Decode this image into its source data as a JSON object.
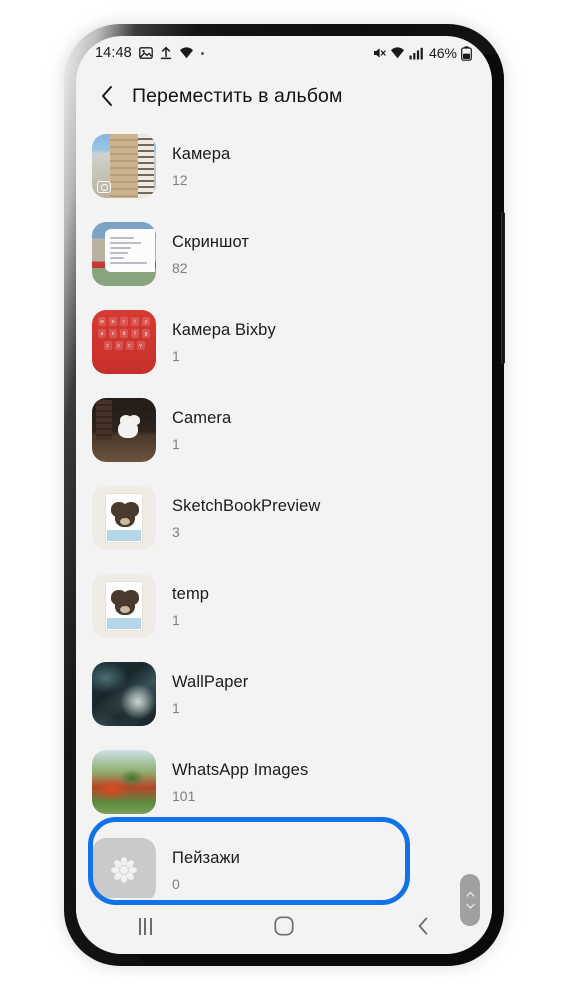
{
  "status_bar": {
    "time": "14:48",
    "left_icons": [
      "image-icon",
      "upload-icon",
      "wifi-calling-icon",
      "dot-icon"
    ],
    "right_icons": [
      "mute-icon",
      "wifi-icon",
      "signal-icon",
      "battery-icon"
    ],
    "battery_percent": "46%"
  },
  "header": {
    "back_icon": "chevron-left-icon",
    "title": "Переместить в альбом"
  },
  "albums": [
    {
      "name": "Камера",
      "count": "12",
      "thumb": "building-photo",
      "badge": "camera-badge"
    },
    {
      "name": "Скриншот",
      "count": "82",
      "thumb": "screenshot-photo",
      "badge": ""
    },
    {
      "name": "Камера Bixby",
      "count": "1",
      "thumb": "red-keyboard-photo",
      "badge": ""
    },
    {
      "name": "Camera",
      "count": "1",
      "thumb": "white-cat-photo",
      "badge": ""
    },
    {
      "name": "SketchBookPreview",
      "count": "3",
      "thumb": "bear-drawing",
      "badge": ""
    },
    {
      "name": "temp",
      "count": "1",
      "thumb": "bear-drawing",
      "badge": ""
    },
    {
      "name": "WallPaper",
      "count": "1",
      "thumb": "dark-abstract-photo",
      "badge": ""
    },
    {
      "name": "WhatsApp Images",
      "count": "101",
      "thumb": "flowers-photo",
      "badge": ""
    },
    {
      "name": "Пейзажи",
      "count": "0",
      "thumb": "empty-album-placeholder",
      "badge": ""
    }
  ],
  "keyboard_thumb": {
    "row1": [
      "w",
      "e",
      "r",
      "t",
      "y"
    ],
    "row2": [
      "a",
      "s",
      "d",
      "f",
      "g"
    ],
    "row3": [
      "z",
      "x",
      "c",
      "v"
    ]
  },
  "scrollbar": {
    "up_icon": "chevron-up-icon",
    "down_icon": "chevron-down-icon"
  },
  "nav_bar": {
    "recents_label": "recents-icon",
    "home_label": "home-icon",
    "back_label": "back-icon"
  },
  "annotation": {
    "color": "#1273e8",
    "target": "Пейзажи"
  }
}
